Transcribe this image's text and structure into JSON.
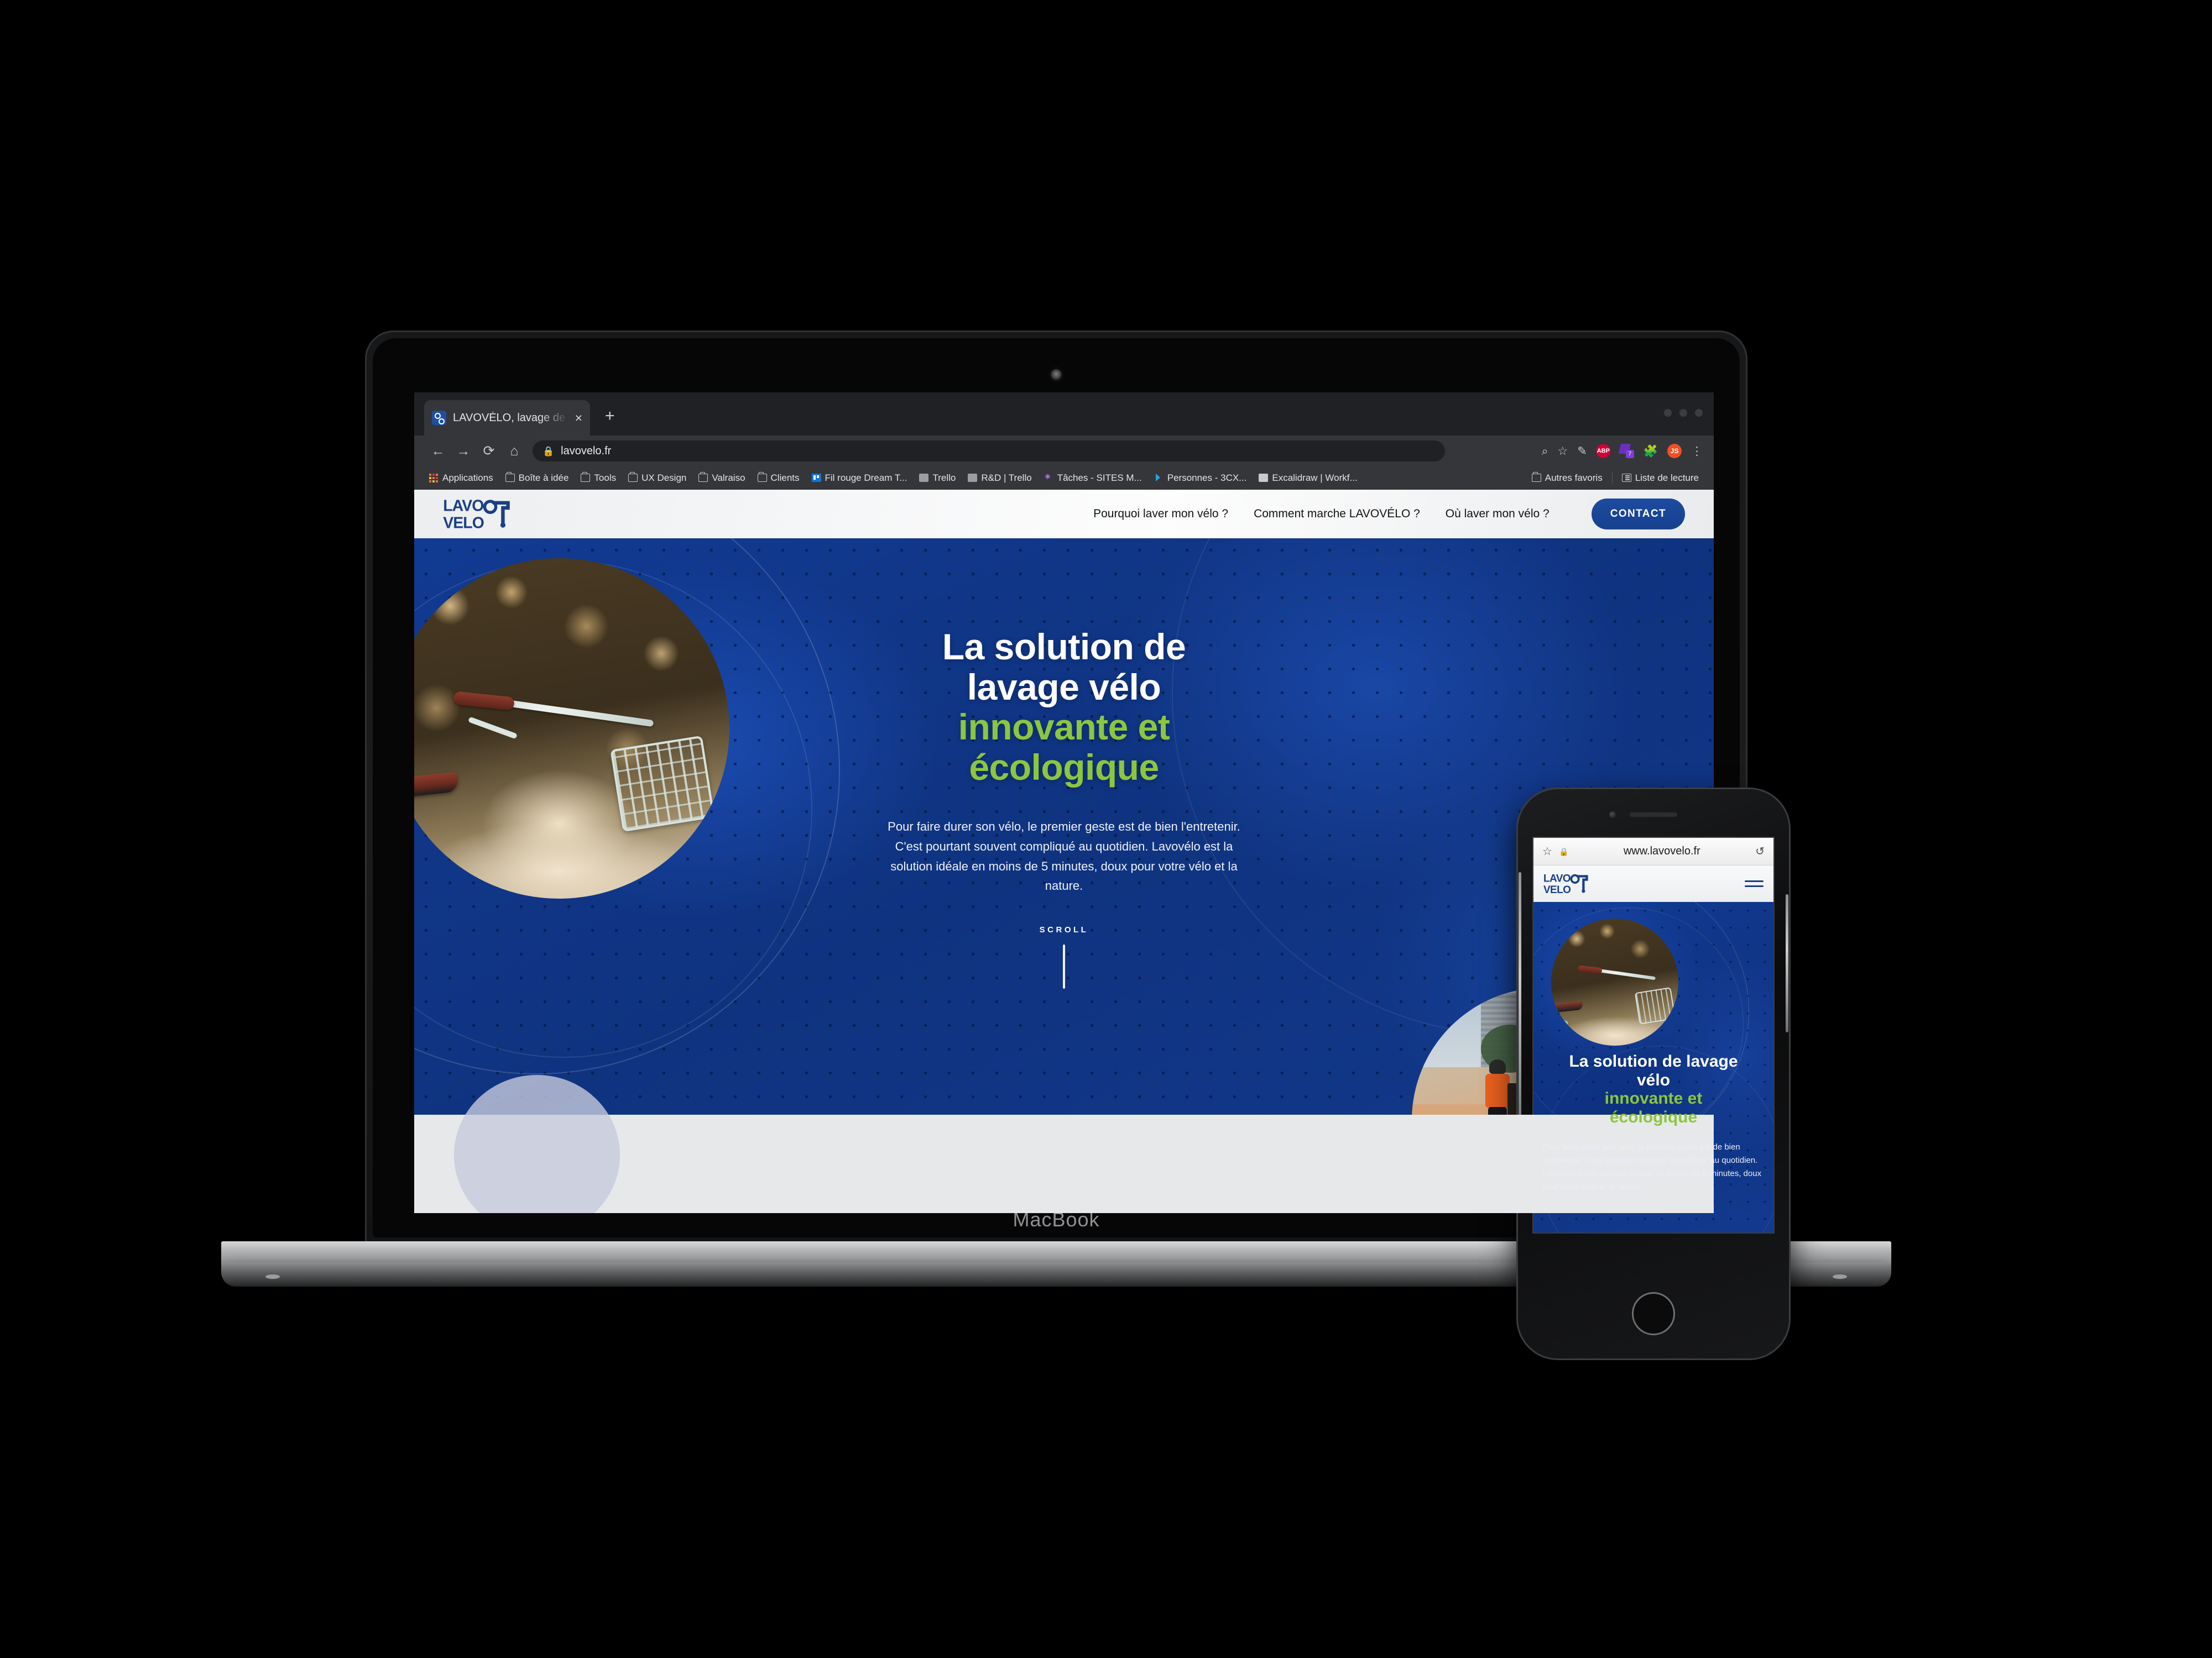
{
  "device": {
    "laptop_label": "MacBook"
  },
  "browser": {
    "tab": {
      "title": "LAVOVÉLO, lavage de vélos inn",
      "favicon": "lavovelo-favicon",
      "close": "×"
    },
    "new_tab": "+",
    "nav": {
      "back": "←",
      "forward": "→",
      "reload": "⟳",
      "home": "⌂"
    },
    "omnibox": {
      "lock": "🔒",
      "url": "lavovelo.fr"
    },
    "toolbar_icons": [
      {
        "name": "zoom-out-icon",
        "glyph": "⌕"
      },
      {
        "name": "bookmark-star-icon",
        "glyph": "☆"
      },
      {
        "name": "pen-annotate-icon",
        "glyph": "✎"
      },
      {
        "name": "adblock-plus-icon",
        "label": "ABP"
      },
      {
        "name": "purple-extension-icon",
        "badge": "7"
      },
      {
        "name": "extensions-puzzle-icon",
        "glyph": "🧩"
      },
      {
        "name": "js-extension-icon",
        "label": "JS"
      },
      {
        "name": "chrome-menu-icon",
        "glyph": "⋮"
      }
    ],
    "bookmarks": [
      {
        "label": "Applications",
        "icon": "apps-grid-icon"
      },
      {
        "label": "Boîte à idée",
        "icon": "folder-icon"
      },
      {
        "label": "Tools",
        "icon": "folder-icon"
      },
      {
        "label": "UX Design",
        "icon": "folder-icon"
      },
      {
        "label": "Valraiso",
        "icon": "folder-icon"
      },
      {
        "label": "Clients",
        "icon": "folder-icon"
      },
      {
        "label": "Fil rouge Dream T...",
        "icon": "trello-icon"
      },
      {
        "label": "Trello",
        "icon": "trello-grey-icon"
      },
      {
        "label": "R&D | Trello",
        "icon": "trello-grey-icon"
      },
      {
        "label": "Tâches - SITES M...",
        "icon": "purple-star-icon"
      },
      {
        "label": "Personnes - 3CX...",
        "icon": "chevron-right-icon"
      },
      {
        "label": "Excalidraw | Workf...",
        "icon": "excalidraw-icon"
      }
    ],
    "bookmarks_right": [
      {
        "label": "Autres favoris",
        "icon": "folder-icon"
      },
      {
        "label": "Liste de lecture",
        "icon": "reading-list-icon"
      }
    ]
  },
  "site": {
    "logo": {
      "line1": "LAVO",
      "line2": "VELO",
      "alt": "lavovelo-logo"
    },
    "nav_links": [
      "Pourquoi laver mon vélo ?",
      "Comment marche LAVOVÉLO ?",
      "Où laver mon vélo ?"
    ],
    "contact_button": "CONTACT",
    "hero": {
      "heading_line1": "La solution de",
      "heading_line2": "lavage vélo",
      "heading_green1": "innovante et",
      "heading_green2": "écologique",
      "paragraph": "Pour faire durer son vélo, le premier geste est de bien l'entretenir.  C'est pourtant souvent compliqué au quotidien. Lavovélo est la solution idéale en moins de 5 minutes, doux pour votre vélo et la nature.",
      "scroll_label": "SCROLL"
    },
    "images": {
      "left_circle": "bicycle-handlebar-photo",
      "right_circle": "bike-wash-station-photo"
    }
  },
  "phone": {
    "browser": {
      "star": "☆",
      "lock": "🔒",
      "url": "www.lavovelo.fr",
      "reload": "↺"
    },
    "logo": {
      "line1": "LAVO",
      "line2": "VELO"
    },
    "menu": "hamburger-menu",
    "hero": {
      "heading_line1": "La solution de lavage",
      "heading_line2": "vélo",
      "heading_green1": "innovante et",
      "heading_green2": "écologique",
      "paragraph": "Pour faire durer son vélo, le premier geste est de bien l'entretenir.  C'est pourtant souvent compliqué au quotidien. Lavovélo est la solution idéale en moins de 5 minutes, doux pour votre vélo et la nature."
    }
  },
  "colors": {
    "brand_blue": "#1b3f87",
    "hero_blue": "#0f3380",
    "accent_green": "#8cc63f",
    "contact_blue": "#1d4ba0",
    "light_section": "#e7e8ea"
  }
}
